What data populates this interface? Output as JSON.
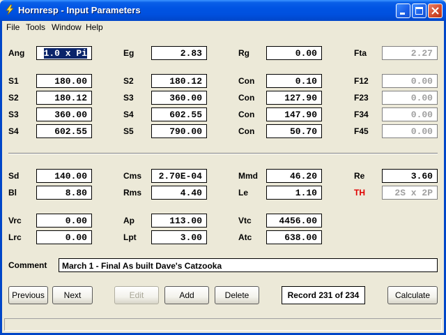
{
  "window": {
    "title": "Hornresp - Input Parameters"
  },
  "menu": [
    "File",
    "Tools",
    "Window",
    "Help"
  ],
  "fields": {
    "ang": {
      "label": "Ang",
      "value": "1.0 x Pi"
    },
    "eg": {
      "label": "Eg",
      "value": "2.83"
    },
    "rg": {
      "label": "Rg",
      "value": "0.00"
    },
    "fta": {
      "label": "Fta",
      "value": "2.27"
    },
    "s1a": {
      "label": "S1",
      "value": "180.00"
    },
    "s2a": {
      "label": "S2",
      "value": "180.12"
    },
    "s3a": {
      "label": "S3",
      "value": "360.00"
    },
    "s4a": {
      "label": "S4",
      "value": "602.55"
    },
    "s2b": {
      "label": "S2",
      "value": "180.12"
    },
    "s3b": {
      "label": "S3",
      "value": "360.00"
    },
    "s4b": {
      "label": "S4",
      "value": "602.55"
    },
    "s5b": {
      "label": "S5",
      "value": "790.00"
    },
    "con1": {
      "label": "Con",
      "value": "0.10"
    },
    "con2": {
      "label": "Con",
      "value": "127.90"
    },
    "con3": {
      "label": "Con",
      "value": "147.90"
    },
    "con4": {
      "label": "Con",
      "value": "50.70"
    },
    "f12": {
      "label": "F12",
      "value": "0.00"
    },
    "f23": {
      "label": "F23",
      "value": "0.00"
    },
    "f34": {
      "label": "F34",
      "value": "0.00"
    },
    "f45": {
      "label": "F45",
      "value": "0.00"
    },
    "sd": {
      "label": "Sd",
      "value": "140.00"
    },
    "bl": {
      "label": "Bl",
      "value": "8.80"
    },
    "cms": {
      "label": "Cms",
      "value": "2.70E-04"
    },
    "rms": {
      "label": "Rms",
      "value": "4.40"
    },
    "mmd": {
      "label": "Mmd",
      "value": "46.20"
    },
    "le": {
      "label": "Le",
      "value": "1.10"
    },
    "re": {
      "label": "Re",
      "value": "3.60"
    },
    "th": {
      "label": "TH",
      "value": "2S x 2P"
    },
    "vrc": {
      "label": "Vrc",
      "value": "0.00"
    },
    "lrc": {
      "label": "Lrc",
      "value": "0.00"
    },
    "ap": {
      "label": "Ap",
      "value": "113.00"
    },
    "lpt": {
      "label": "Lpt",
      "value": "3.00"
    },
    "vtc": {
      "label": "Vtc",
      "value": "4456.00"
    },
    "atc": {
      "label": "Atc",
      "value": "638.00"
    }
  },
  "comment": {
    "label": "Comment",
    "value": "March 1 - Final As built Dave's Catzooka"
  },
  "buttons": {
    "previous": "Previous",
    "next": "Next",
    "edit": "Edit",
    "add": "Add",
    "delete": "Delete",
    "calculate": "Calculate"
  },
  "record": "Record 231 of 234",
  "colors": {
    "titlebar": "#0054E3",
    "window_bg": "#ECE9D8",
    "th_label": "#E00000",
    "selection": "#0A246A"
  }
}
